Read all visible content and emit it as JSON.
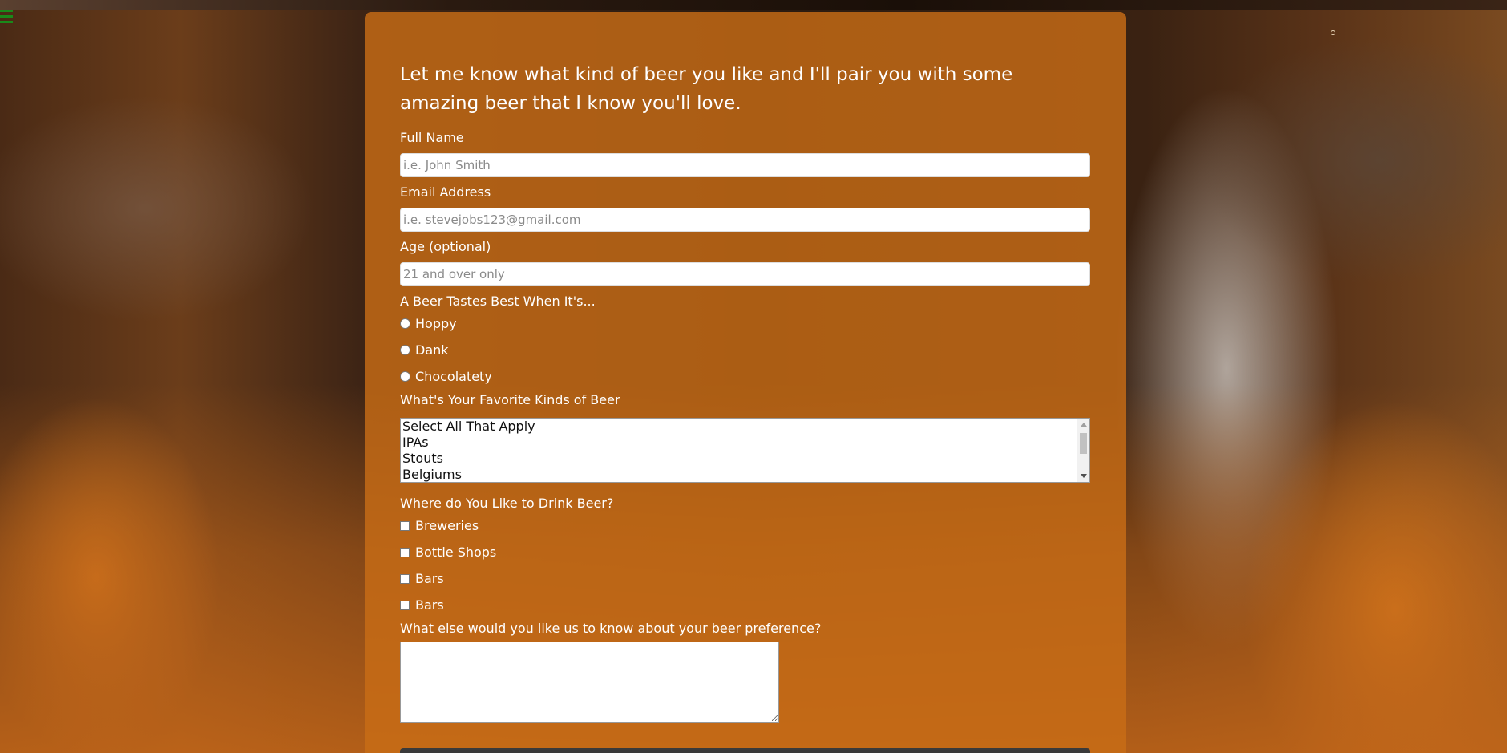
{
  "page": {
    "menu_icon": "hamburger-menu-icon",
    "accent_color": "#c86c16",
    "menu_color": "#1a8a1a"
  },
  "form": {
    "heading": "Let me know what kind of beer you like and I'll pair you with some amazing beer that I know you'll love.",
    "full_name": {
      "label": "Full Name",
      "placeholder": "i.e. John Smith",
      "value": ""
    },
    "email": {
      "label": "Email Address",
      "placeholder": "i.e. stevejobs123@gmail.com",
      "value": ""
    },
    "age": {
      "label": "Age (optional)",
      "placeholder": "21 and over only",
      "value": ""
    },
    "taste": {
      "label": "A Beer Tastes Best When It's...",
      "options": [
        "Hoppy",
        "Dank",
        "Chocolatety"
      ]
    },
    "favorites": {
      "label": "What's Your Favorite Kinds of Beer",
      "options": [
        "Select All That Apply",
        "IPAs",
        "Stouts",
        "Belgiums"
      ]
    },
    "where": {
      "label": "Where do You Like to Drink Beer?",
      "options": [
        "Breweries",
        "Bottle Shops",
        "Bars",
        "Bars"
      ]
    },
    "comments": {
      "label": "What else would you like us to know about your beer preference?",
      "value": ""
    }
  }
}
